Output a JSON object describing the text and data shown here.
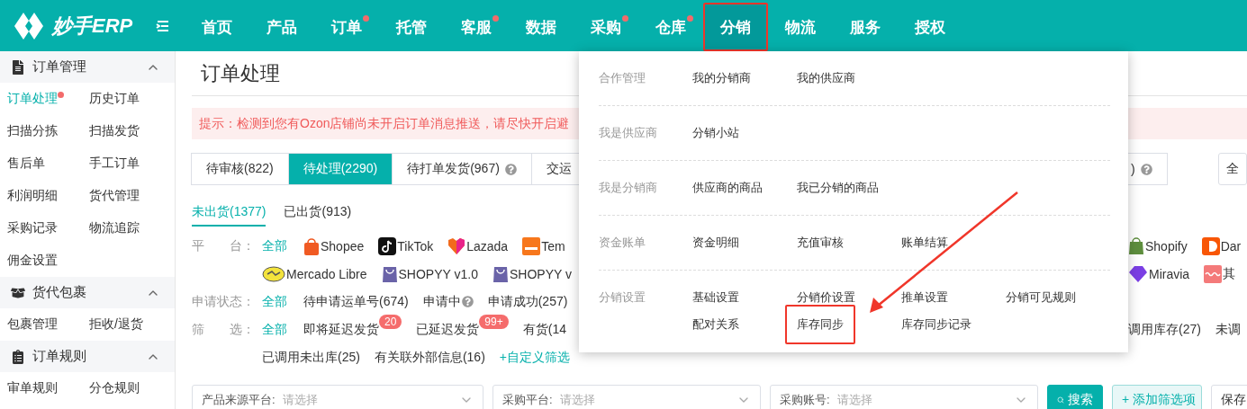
{
  "brand": {
    "name": "妙手ERP"
  },
  "nav": [
    {
      "label": "首页",
      "dot": false,
      "selected": false,
      "highlighted": false
    },
    {
      "label": "产品",
      "dot": false,
      "selected": false,
      "highlighted": false
    },
    {
      "label": "订单",
      "dot": true,
      "selected": false,
      "highlighted": false
    },
    {
      "label": "托管",
      "dot": false,
      "selected": false,
      "highlighted": false
    },
    {
      "label": "客服",
      "dot": true,
      "selected": false,
      "highlighted": false
    },
    {
      "label": "数据",
      "dot": false,
      "selected": false,
      "highlighted": false
    },
    {
      "label": "采购",
      "dot": true,
      "selected": false,
      "highlighted": false
    },
    {
      "label": "仓库",
      "dot": true,
      "selected": false,
      "highlighted": false
    },
    {
      "label": "分销",
      "dot": false,
      "selected": true,
      "highlighted": true
    },
    {
      "label": "物流",
      "dot": false,
      "selected": false,
      "highlighted": false
    },
    {
      "label": "服务",
      "dot": false,
      "selected": false,
      "highlighted": false
    },
    {
      "label": "授权",
      "dot": false,
      "selected": false,
      "highlighted": false
    }
  ],
  "sidebar": [
    {
      "kind": "orders",
      "title": "订单管理",
      "expanded": true,
      "items": [
        {
          "label": "订单处理",
          "selected": true,
          "dot": true
        },
        {
          "label": "历史订单",
          "selected": false,
          "dot": false
        },
        {
          "label": "扫描分拣",
          "selected": false,
          "dot": false
        },
        {
          "label": "扫描发货",
          "selected": false,
          "dot": false
        },
        {
          "label": "售后单",
          "selected": false,
          "dot": false
        },
        {
          "label": "手工订单",
          "selected": false,
          "dot": false
        },
        {
          "label": "利润明细",
          "selected": false,
          "dot": false
        },
        {
          "label": "货代管理",
          "selected": false,
          "dot": false
        },
        {
          "label": "采购记录",
          "selected": false,
          "dot": false
        },
        {
          "label": "物流追踪",
          "selected": false,
          "dot": false
        },
        {
          "label": "佣金设置",
          "selected": false,
          "dot": false
        }
      ]
    },
    {
      "kind": "parcels",
      "title": "货代包裹",
      "expanded": true,
      "items": [
        {
          "label": "包裹管理",
          "selected": false,
          "dot": false
        },
        {
          "label": "拒收/退货",
          "selected": false,
          "dot": false
        }
      ]
    },
    {
      "kind": "rules",
      "title": "订单规则",
      "expanded": true,
      "items": [
        {
          "label": "审单规则",
          "selected": false,
          "dot": false
        },
        {
          "label": "分仓规则",
          "selected": false,
          "dot": false
        }
      ]
    }
  ],
  "page": {
    "title": "订单处理",
    "alert": "提示：检测到您有Ozon店铺尚未开启订单消息推送，请尽快开启避"
  },
  "tabs": [
    {
      "label": "待审核(822)",
      "selected": false,
      "help": false
    },
    {
      "label": "待处理(2290)",
      "selected": true,
      "help": false
    },
    {
      "label": "待打单发货(967)",
      "selected": false,
      "help": true
    },
    {
      "label": "交运",
      "selected": false,
      "help": false
    }
  ],
  "tabs_right": [
    {
      "label": ")",
      "selected": false,
      "help": true
    }
  ],
  "scope_button": "全",
  "subtabs": [
    {
      "label": "未出货(1377)",
      "selected": true
    },
    {
      "label": "已出货(913)",
      "selected": false
    }
  ],
  "filter_rows": [
    {
      "label": "平　　台：",
      "all": "全部",
      "lines": [
        {
          "left": [
            {
              "label": "Shopee",
              "icon": true
            },
            {
              "label": "TikTok",
              "icon": true
            },
            {
              "label": "Lazada",
              "icon": true
            },
            {
              "label": "Tem",
              "icon": true
            }
          ],
          "right": [
            {
              "label": "Shopify",
              "icon": true
            },
            {
              "label": "Dar",
              "icon": true
            }
          ]
        },
        {
          "left": [
            {
              "label": "Mercado Libre",
              "icon": true
            },
            {
              "label": "SHOPYY v1.0",
              "icon": true
            },
            {
              "label": "SHOPYY v",
              "icon": true
            }
          ],
          "right": [
            {
              "label": "Miravia",
              "icon": true
            },
            {
              "label": "其",
              "icon": true
            }
          ]
        }
      ]
    },
    {
      "label": "申请状态：",
      "all": "全部",
      "lines": [
        {
          "left": [
            {
              "label": "待申请运单号(674)"
            },
            {
              "label": "申请中",
              "help": true
            },
            {
              "label": "申请成功(257)"
            }
          ]
        }
      ]
    },
    {
      "label": "筛　　选：",
      "all": "全部",
      "lines": [
        {
          "left": [
            {
              "label": "即将延迟发货",
              "badge": "20"
            },
            {
              "label": "已延迟发货",
              "badge": "99+"
            },
            {
              "label": "有货(14"
            }
          ],
          "right": [
            {
              "label": "调用库存(27)"
            },
            {
              "label": "未调"
            }
          ]
        },
        {
          "left": [
            {
              "label": "已调用未出库(25)"
            },
            {
              "label": "有关联外部信息(16)"
            },
            {
              "label": "+自定义筛选",
              "link": true
            }
          ]
        }
      ]
    }
  ],
  "selects": [
    {
      "label": "产品来源平台:",
      "placeholder": "请选择"
    },
    {
      "label": "采购平台:",
      "placeholder": "请选择"
    },
    {
      "label": "采购账号:",
      "placeholder": "请选择"
    }
  ],
  "actions": [
    {
      "kind": "search",
      "label": "搜索"
    },
    {
      "kind": "add",
      "label": "+ 添加筛选项"
    },
    {
      "kind": "save",
      "label": "保存"
    }
  ],
  "menu": [
    {
      "label": "合作管理",
      "items": [
        {
          "label": "我的分销商",
          "highlighted": false
        },
        {
          "label": "我的供应商",
          "highlighted": false
        }
      ]
    },
    {
      "label": "我是供应商",
      "items": [
        {
          "label": "分销小站",
          "highlighted": false
        }
      ]
    },
    {
      "label": "我是分销商",
      "items": [
        {
          "label": "供应商的商品",
          "highlighted": false
        },
        {
          "label": "我已分销的商品",
          "highlighted": false
        }
      ]
    },
    {
      "label": "资金账单",
      "items": [
        {
          "label": "资金明细",
          "highlighted": false
        },
        {
          "label": "充值审核",
          "highlighted": false
        },
        {
          "label": "账单结算",
          "highlighted": false
        }
      ]
    },
    {
      "label": "分销设置",
      "items": [
        {
          "label": "基础设置",
          "highlighted": false
        },
        {
          "label": "分销价设置",
          "highlighted": false
        },
        {
          "label": "推单设置",
          "highlighted": false
        },
        {
          "label": "分销可见规则",
          "highlighted": false
        },
        {
          "label": "配对关系",
          "highlighted": false
        },
        {
          "label": "库存同步",
          "highlighted": true
        },
        {
          "label": "库存同步记录",
          "highlighted": false
        }
      ]
    }
  ]
}
